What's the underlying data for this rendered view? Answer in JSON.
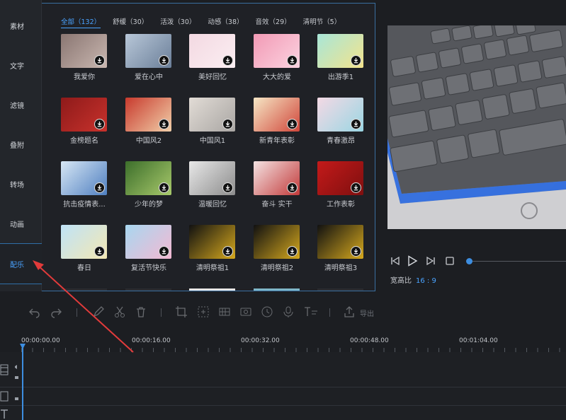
{
  "sidebar": {
    "items": [
      {
        "label": "素材"
      },
      {
        "label": "文字"
      },
      {
        "label": "滤镜"
      },
      {
        "label": "叠附"
      },
      {
        "label": "转场"
      },
      {
        "label": "动画"
      },
      {
        "label": "配乐"
      }
    ],
    "active_index": 6
  },
  "tabs": [
    {
      "label": "全部（132）"
    },
    {
      "label": "舒缓（30）"
    },
    {
      "label": "活泼（30）"
    },
    {
      "label": "动感（38）"
    },
    {
      "label": "音效（29）"
    },
    {
      "label": "清明节（5）"
    }
  ],
  "templates": [
    {
      "label": "我爱你",
      "colors": [
        "#8a7672",
        "#c9b7b0"
      ]
    },
    {
      "label": "爱在心中",
      "colors": [
        "#b8c7d8",
        "#6b7f99"
      ]
    },
    {
      "label": "美好回忆",
      "colors": [
        "#f3d9e2",
        "#fbeef2"
      ]
    },
    {
      "label": "大大的爱",
      "colors": [
        "#f29ab5",
        "#fbd3e0"
      ]
    },
    {
      "label": "出游季1",
      "colors": [
        "#a8e6d8",
        "#f3e38c"
      ]
    },
    {
      "label": "金榜题名",
      "colors": [
        "#8e1a1a",
        "#c8322c"
      ]
    },
    {
      "label": "中国风2",
      "colors": [
        "#c83a2d",
        "#f1cfa9"
      ]
    },
    {
      "label": "中国风1",
      "colors": [
        "#e2dcd6",
        "#a9a6a3"
      ]
    },
    {
      "label": "新青年表彰",
      "colors": [
        "#f6e7c5",
        "#d0463a"
      ]
    },
    {
      "label": "青春激昂",
      "colors": [
        "#f4d9e4",
        "#9ad6e3"
      ]
    },
    {
      "label": "抗击疫情表...",
      "colors": [
        "#d7e7f5",
        "#4f7fc0"
      ]
    },
    {
      "label": "少年的梦",
      "colors": [
        "#3c6e2b",
        "#a8c96b"
      ]
    },
    {
      "label": "温暖回忆",
      "colors": [
        "#e8e8e8",
        "#8c8c8c"
      ]
    },
    {
      "label": "奋斗 实干",
      "colors": [
        "#f4e3e3",
        "#c23a3a"
      ]
    },
    {
      "label": "工作表彰",
      "colors": [
        "#c41a1a",
        "#7e0f0f"
      ]
    },
    {
      "label": "春日",
      "colors": [
        "#bfe3f7",
        "#f3e7b3"
      ]
    },
    {
      "label": "复活节快乐",
      "colors": [
        "#a8d7f0",
        "#f3b9d2"
      ]
    },
    {
      "label": "清明祭祖1",
      "colors": [
        "#111111",
        "#d6a91e"
      ]
    },
    {
      "label": "清明祭祖2",
      "colors": [
        "#111111",
        "#d6a91e"
      ]
    },
    {
      "label": "清明祭祖3",
      "colors": [
        "#111111",
        "#d6a91e"
      ]
    }
  ],
  "preview": {
    "ratio_label": "宽高比",
    "ratio_value": "16 : 9"
  },
  "toolbar": {
    "export_label": "导出"
  },
  "timeline": {
    "timecodes": [
      "00:00:00.00",
      "00:00:16.00",
      "00:00:32.00",
      "00:00:48.00",
      "00:01:04.00"
    ]
  },
  "colors": {
    "accent": "#4aa3ff",
    "annotation_arrow": "#e23b3b"
  }
}
